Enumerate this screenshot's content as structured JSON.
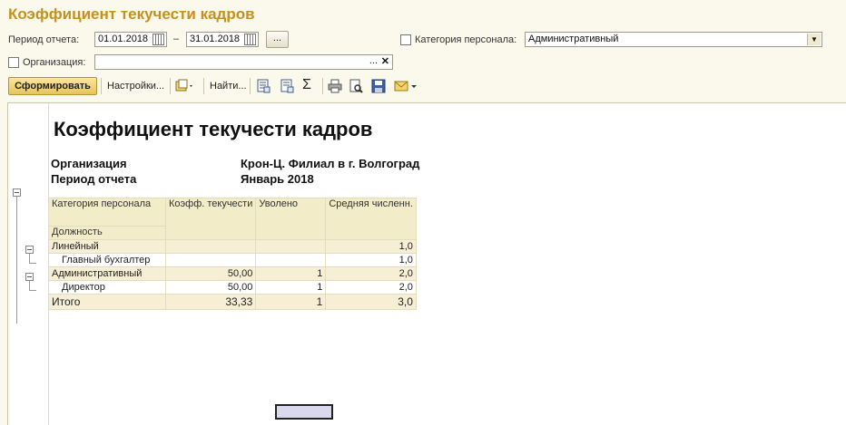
{
  "window": {
    "title": "Коэффициент текучести кадров"
  },
  "filters": {
    "period_label": "Период отчета:",
    "date_from": "01.01.2018",
    "date_sep": "–",
    "date_to": "31.01.2018",
    "more_label": "...",
    "category_label": "Категория персонала:",
    "category_value": "Административный",
    "org_label": "Организация:",
    "org_value": "",
    "org_select_label": "...",
    "org_clear_label": "✕"
  },
  "toolbar": {
    "generate_label": "Сформировать",
    "settings_label": "Настройки...",
    "find_label": "Найти...",
    "sum_symbol": "Σ"
  },
  "report": {
    "title": "Коэффициент текучести кадров",
    "org_key": "Организация",
    "org_value": "Крон-Ц. Филиал в г. Волгоград",
    "period_key": "Период отчета",
    "period_value": "Январь 2018",
    "columns": {
      "category": "Категория персонала",
      "position": "Должность",
      "coef": "Коэфф. текучести",
      "dismissed": "Уволено",
      "avg": "Средняя численн."
    },
    "rows": [
      {
        "name": "Линейный",
        "coef": "",
        "dismissed": "",
        "avg": "1,0"
      },
      {
        "name": "Главный бухгалтер",
        "coef": "",
        "dismissed": "",
        "avg": "1,0"
      },
      {
        "name": "Административный",
        "coef": "50,00",
        "dismissed": "1",
        "avg": "2,0"
      },
      {
        "name": "Директор",
        "coef": "50,00",
        "dismissed": "1",
        "avg": "2,0"
      }
    ],
    "total": {
      "name": "Итого",
      "coef": "33,33",
      "dismissed": "1",
      "avg": "3,0"
    }
  }
}
